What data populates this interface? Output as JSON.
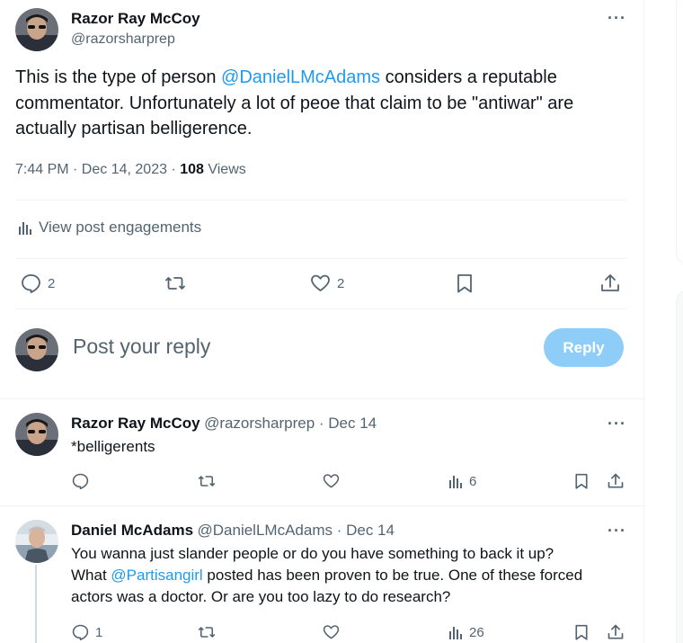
{
  "main_post": {
    "author_name": "Razor Ray McCoy",
    "author_handle": "@razorsharprep",
    "text_before": "This is the type of person ",
    "mention": "@DanielLMcAdams",
    "text_after": " considers a reputable commentator. Unfortunately a lot of peoe that claim to be \"antiwar\" are actually partisan belligerence.",
    "time": "7:44 PM · Dec 14, 2023 · ",
    "views_count": "108",
    "views_label": " Views",
    "engagements_label": "View post engagements",
    "replies": "2",
    "likes": "2"
  },
  "reply_box": {
    "placeholder": "Post your reply",
    "button": "Reply"
  },
  "replies": [
    {
      "author_name": "Razor Ray McCoy",
      "meta": "@razorsharprep · Dec 14",
      "text": "*belligerents",
      "views": "6"
    },
    {
      "author_name": "Daniel McAdams",
      "meta": "@DanielLMcAdams · Dec 14",
      "line1": "You wanna just slander people or do you have something to back it up?",
      "line2_before": "What ",
      "line2_mention": "@Partisangirl",
      "line2_after": " posted has been proven to be true. One of these forced",
      "line3": "actors was a doctor. Or are you too lazy to do research?",
      "reply_count": "1",
      "views": "26"
    }
  ],
  "colors": {
    "accent": "#1d9bf0",
    "muted": "#536471",
    "reply_button_disabled": "#8ecdf8"
  }
}
